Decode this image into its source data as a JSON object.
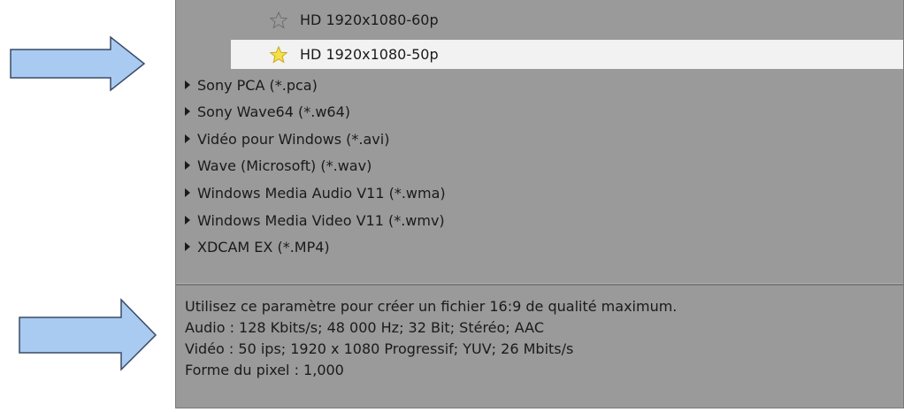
{
  "presets": [
    {
      "label": "HD 1920x1080-60p",
      "favorite": false,
      "selected": false
    },
    {
      "label": "HD 1920x1080-50p",
      "favorite": true,
      "selected": true
    }
  ],
  "formats": [
    "Sony PCA (*.pca)",
    "Sony Wave64 (*.w64)",
    "Vidéo pour Windows (*.avi)",
    "Wave (Microsoft) (*.wav)",
    "Windows Media Audio V11 (*.wma)",
    "Windows Media Video V11 (*.wmv)",
    "XDCAM EX (*.MP4)"
  ],
  "description": {
    "summary": "Utilisez ce paramètre pour créer un fichier 16:9 de qualité maximum.",
    "audio": "Audio : 128 Kbits/s; 48 000 Hz; 32 Bit; Stéréo; AAC",
    "video": "Vidéo : 50 ips; 1920 x 1080 Progressif; YUV; 26 Mbits/s",
    "pixel": "Forme du pixel : 1,000"
  },
  "colors": {
    "panel_bg": "#9a9a9a",
    "selected_row_bg": "#f2f2f2",
    "arrow_fill": "#a9cbf2",
    "arrow_stroke": "#3a4a66",
    "star_gold": "#f5e04a"
  },
  "icons": {
    "arrow": "right-arrow-icon",
    "star_empty": "star-outline-icon",
    "star_filled": "star-filled-icon",
    "expand": "triangle-right-icon"
  }
}
